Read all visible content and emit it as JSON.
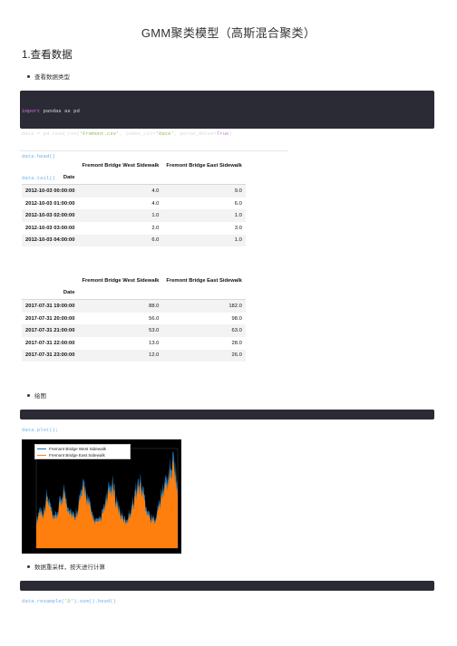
{
  "page": {
    "title": "GMM聚类模型（高斯混合聚类）",
    "section_heading": "1.查看数据"
  },
  "bullets": {
    "view_types": "查看数据类型",
    "plot": "绘图",
    "resample": "数据重采样，按天进行计算"
  },
  "code": {
    "block1": [
      {
        "kw": "import",
        "rest": " pandas as pd"
      },
      {
        "pre": "data = pd.read_csv(",
        "str": "'Fremont.csv'",
        "mid": ", index_col=",
        "str2": "'Date'",
        "post": ", parse_dates=",
        "kw2": "True",
        "end": ")"
      },
      {
        "plain": "data.head()"
      },
      {
        "plain": "data.tail()"
      }
    ],
    "block2": "data.plot();",
    "block3": "data.resample('D').sum().head()"
  },
  "table_head": {
    "columns": [
      "Fremont Bridge West Sidewalk",
      "Fremont Bridge East Sidewalk"
    ],
    "index_name": "Date",
    "rows": [
      [
        "2012-10-03 00:00:00",
        "4.0",
        "9.0"
      ],
      [
        "2012-10-03 01:00:00",
        "4.0",
        "6.0"
      ],
      [
        "2012-10-03 02:00:00",
        "1.0",
        "1.0"
      ],
      [
        "2012-10-03 03:00:00",
        "2.0",
        "3.0"
      ],
      [
        "2012-10-03 04:00:00",
        "6.0",
        "1.0"
      ]
    ]
  },
  "table_tail": {
    "columns": [
      "Fremont Bridge West Sidewalk",
      "Fremont Bridge East Sidewalk"
    ],
    "index_name": "Date",
    "rows": [
      [
        "2017-07-31 19:00:00",
        "88.0",
        "182.0"
      ],
      [
        "2017-07-31 20:00:00",
        "56.0",
        "98.0"
      ],
      [
        "2017-07-31 21:00:00",
        "53.0",
        "63.0"
      ],
      [
        "2017-07-31 22:00:00",
        "13.0",
        "28.0"
      ],
      [
        "2017-07-31 23:00:00",
        "12.0",
        "26.0"
      ]
    ]
  },
  "chart_data": {
    "type": "area",
    "series": [
      {
        "name": "Fremont Bridge West Sidewalk",
        "color": "#1f77b4"
      },
      {
        "name": "Fremont Bridge East Sidewalk",
        "color": "#ff7f0e"
      }
    ],
    "legend": "top-left",
    "background": "#000000",
    "relative_levels": [
      0.28,
      0.42,
      0.38,
      0.55,
      0.46,
      0.3,
      0.36,
      0.5,
      0.62,
      0.48,
      0.4,
      0.33,
      0.44,
      0.58,
      0.66,
      0.52,
      0.38,
      0.3,
      0.27,
      0.35,
      0.47,
      0.6,
      0.68,
      0.55,
      0.42,
      0.32,
      0.29,
      0.37,
      0.49,
      0.63,
      0.71,
      0.6,
      0.44,
      0.33,
      0.3,
      0.38,
      0.52,
      0.66,
      0.74,
      0.85,
      0.95,
      0.62
    ]
  }
}
